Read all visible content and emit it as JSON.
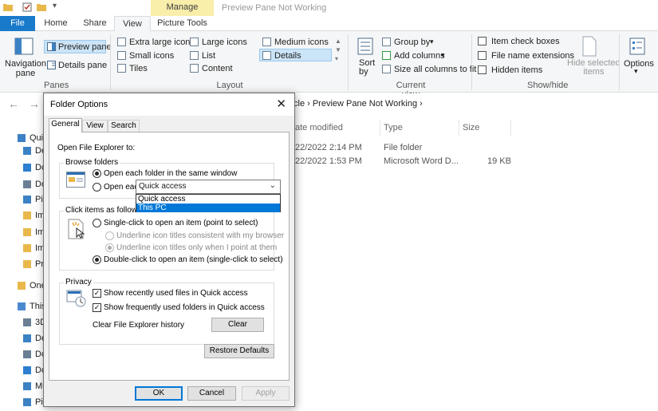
{
  "window": {
    "title": "Preview Pane Not Working",
    "context_tab": "Manage"
  },
  "ribbon_tabs": {
    "file": "File",
    "home": "Home",
    "share": "Share",
    "view": "View",
    "picture_tools": "Picture Tools"
  },
  "ribbon": {
    "panes": {
      "navigation_pane": "Navigation\npane",
      "preview_pane": "Preview pane",
      "details_pane": "Details pane",
      "group": "Panes"
    },
    "layout": {
      "extra_large": "Extra large icons",
      "large": "Large icons",
      "medium": "Medium icons",
      "small": "Small icons",
      "list": "List",
      "details": "Details",
      "tiles": "Tiles",
      "content": "Content",
      "group": "Layout"
    },
    "current_view": {
      "sort_by": "Sort\nby",
      "group_by": "Group by",
      "add_columns": "Add columns",
      "size_all": "Size all columns to fit",
      "group": "Current view"
    },
    "show_hide": {
      "item_check_boxes": "Item check boxes",
      "file_name_extensions": "File name extensions",
      "hidden_items": "Hidden items",
      "hide_selected": "Hide selected\nitems",
      "group": "Show/hide"
    },
    "options": "Options"
  },
  "explorer": {
    "breadcrumb_tail": "cle  ›  Preview Pane Not Working  ›",
    "columns": {
      "date": "ate modified",
      "type": "Type",
      "size": "Size"
    },
    "rows": [
      {
        "date": "22/2022 2:14 PM",
        "type": "File folder",
        "size": ""
      },
      {
        "date": "22/2022 1:53 PM",
        "type": "Microsoft Word D...",
        "size": "19 KB"
      }
    ],
    "nav_items": [
      "Quic",
      "De",
      "Do",
      "Do",
      "Pic",
      "Im",
      "Im",
      "Im",
      "Pro",
      "One",
      "This",
      "3D",
      "De",
      "Do",
      "Do",
      "Mu",
      "Pic"
    ]
  },
  "dialog": {
    "title": "Folder Options",
    "tabs": [
      "General",
      "View",
      "Search"
    ],
    "open_to_label": "Open File Explorer to:",
    "open_to_value": "Quick access",
    "open_to_options": [
      "Quick access",
      "This PC"
    ],
    "browse_folders": {
      "title": "Browse folders",
      "same_window": "Open each folder in the same window",
      "own_window": "Open each folder in its own window"
    },
    "click_items": {
      "title": "Click items as follows",
      "single_click": "Single-click to open an item (point to select)",
      "underline_consistent": "Underline icon titles consistent with my browser",
      "underline_point": "Underline icon titles only when I point at them",
      "double_click": "Double-click to open an item (single-click to select)"
    },
    "privacy": {
      "title": "Privacy",
      "recent_files": "Show recently used files in Quick access",
      "frequent_folders": "Show frequently used folders in Quick access",
      "clear_history": "Clear File Explorer history",
      "clear_button": "Clear"
    },
    "restore_defaults": "Restore Defaults",
    "ok": "OK",
    "cancel": "Cancel",
    "apply": "Apply"
  },
  "colors": {
    "accent": "#0078d7",
    "file_tab": "#1979ca",
    "manage_tab": "#f9eeaa"
  }
}
